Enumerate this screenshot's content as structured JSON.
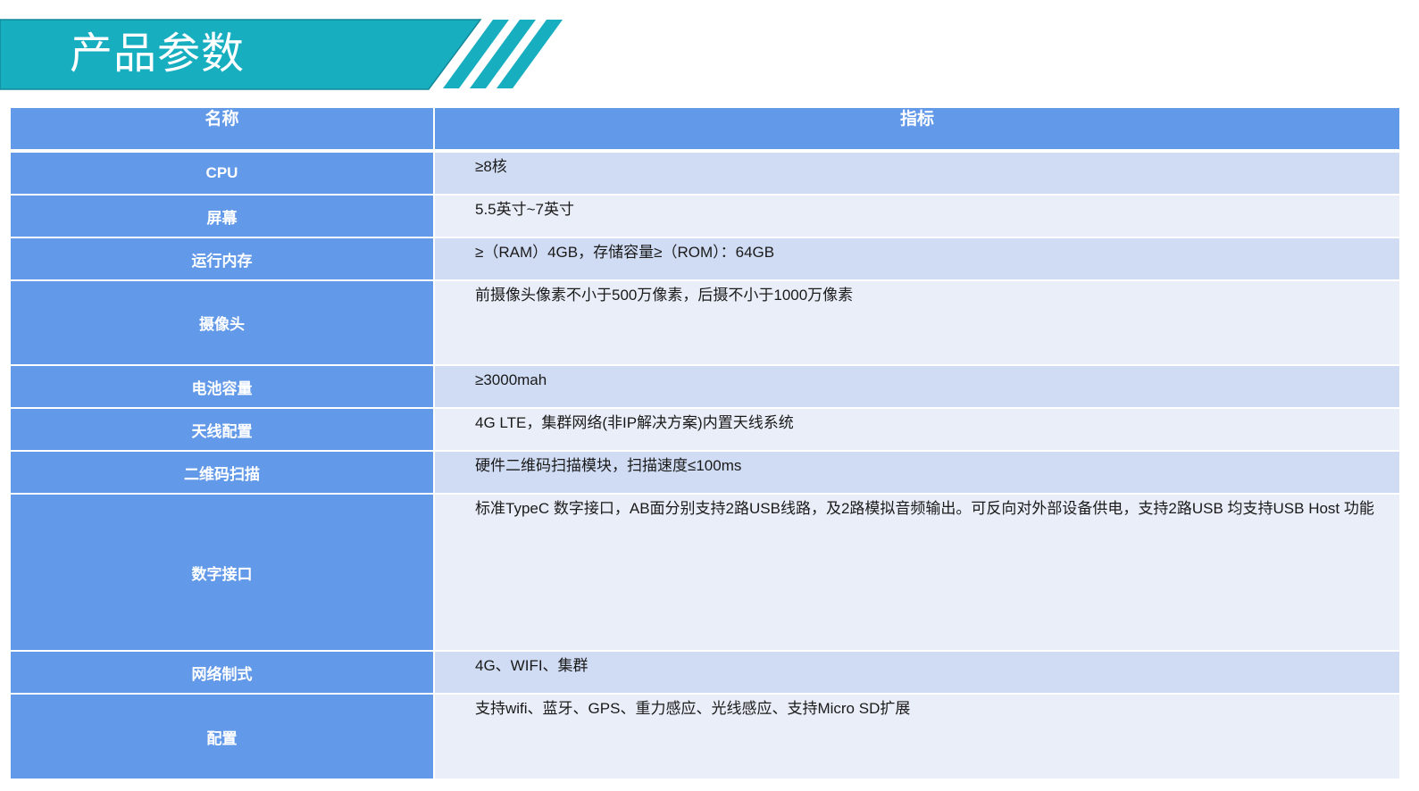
{
  "header": {
    "title": "产品参数"
  },
  "colors": {
    "banner_teal": "#17aec0",
    "banner_border": "#12889a",
    "table_header_blue": "#6299e8",
    "row_dark": "#d0dcf3",
    "row_light": "#e9eef8"
  },
  "table": {
    "headers": {
      "name": "名称",
      "value": "指标"
    },
    "rows": [
      {
        "name": "CPU",
        "value": "≥8核"
      },
      {
        "name": "屏幕",
        "value": "5.5英寸~7英寸"
      },
      {
        "name": "运行内存",
        "value": "≥（RAM）4GB，存储容量≥（ROM）：64GB"
      },
      {
        "name": "摄像头",
        "value": "前摄像头像素不小于500万像素，后摄不小于1000万像素"
      },
      {
        "name": "电池容量",
        "value": "≥3000mah"
      },
      {
        "name": "天线配置",
        "value": "4G LTE，集群网络(非IP解决方案)内置天线系统"
      },
      {
        "name": "二维码扫描",
        "value": "硬件二维码扫描模块，扫描速度≤100ms"
      },
      {
        "name": "数字接口",
        "value": "标准TypeC 数字接口，AB面分别支持2路USB线路，及2路模拟音频输出。可反向对外部设备供电，支持2路USB 均支持USB Host 功能"
      },
      {
        "name": "网络制式",
        "value": "4G、WIFI、集群"
      },
      {
        "name": "配置",
        "value": "支持wifi、蓝牙、GPS、重力感应、光线感应、支持Micro SD扩展"
      }
    ]
  }
}
